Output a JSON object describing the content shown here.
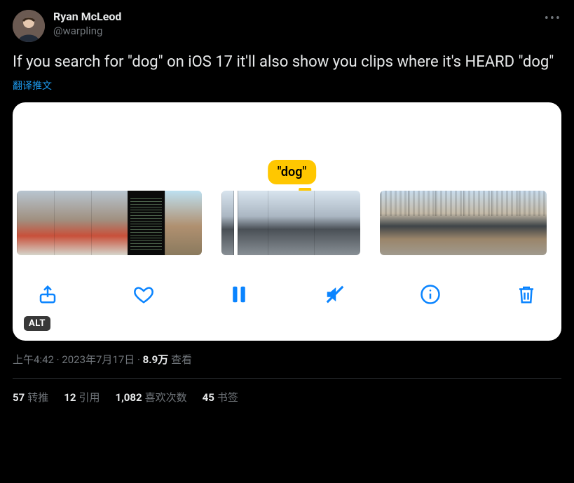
{
  "author": {
    "display_name": "Ryan McLeod",
    "handle": "@warpling"
  },
  "body": "If you search for \"dog\" on iOS 17 it'll also show you clips where it's HEARD \"dog\"",
  "translate_label": "翻译推文",
  "media": {
    "highlight_label": "\"dog\"",
    "alt_badge": "ALT"
  },
  "timestamp": "上午4:42 · 2023年7月17日",
  "views": {
    "count": "8.9万",
    "label": "查看"
  },
  "stats": {
    "retweets": {
      "count": "57",
      "label": "转推"
    },
    "quotes": {
      "count": "12",
      "label": "引用"
    },
    "likes": {
      "count": "1,082",
      "label": "喜欢次数"
    },
    "bookmarks": {
      "count": "45",
      "label": "书签"
    }
  }
}
